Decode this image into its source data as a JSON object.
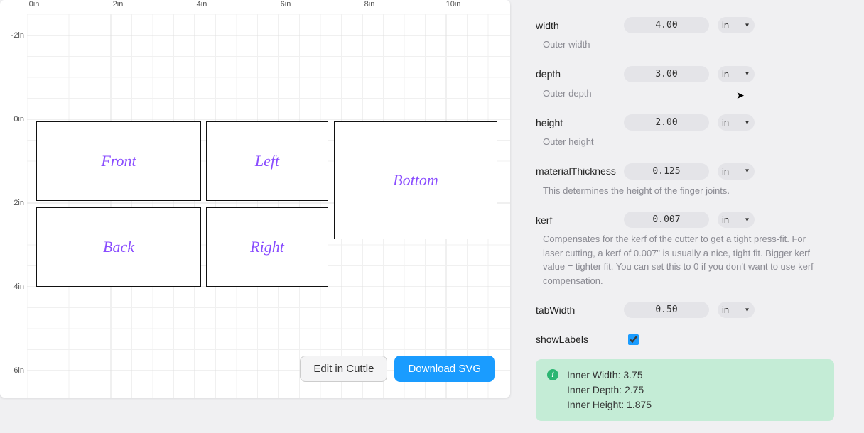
{
  "ruler": {
    "top": [
      "0in",
      "2in",
      "4in",
      "6in",
      "8in",
      "10in"
    ],
    "left": [
      "-2in",
      "0in",
      "2in",
      "4in",
      "6in"
    ]
  },
  "pieces": {
    "front": "Front",
    "left": "Left",
    "back": "Back",
    "right": "Right",
    "bottom": "Bottom"
  },
  "buttons": {
    "edit": "Edit in Cuttle",
    "download": "Download SVG"
  },
  "params": {
    "width": {
      "name": "width",
      "value": "4.00",
      "unit": "in",
      "desc": "Outer width"
    },
    "depth": {
      "name": "depth",
      "value": "3.00",
      "unit": "in",
      "desc": "Outer depth"
    },
    "height": {
      "name": "height",
      "value": "2.00",
      "unit": "in",
      "desc": "Outer height"
    },
    "materialThickness": {
      "name": "materialThickness",
      "value": "0.125",
      "unit": "in",
      "desc": "This determines the height of the finger joints."
    },
    "kerf": {
      "name": "kerf",
      "value": "0.007",
      "unit": "in",
      "desc": "Compensates for the kerf of the cutter to get a tight press-fit. For laser cutting, a kerf of 0.007\" is usually a nice, tight fit. Bigger kerf value = tighter fit. You can set this to 0 if you don't want to use kerf compensation."
    },
    "tabWidth": {
      "name": "tabWidth",
      "value": "0.50",
      "unit": "in"
    },
    "showLabels": {
      "name": "showLabels"
    }
  },
  "info": {
    "innerWidth": "Inner Width: 3.75",
    "innerDepth": "Inner Depth: 2.75",
    "innerHeight": "Inner Height: 1.875"
  }
}
